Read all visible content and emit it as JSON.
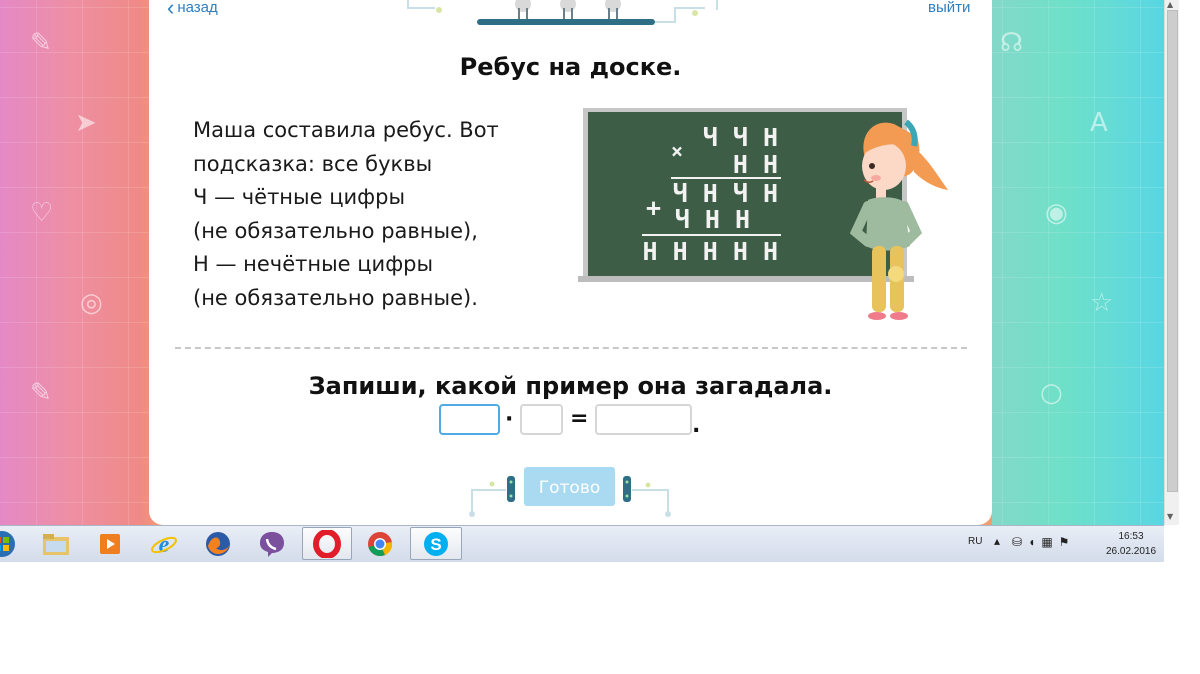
{
  "nav": {
    "back_label": "назад",
    "exit_label": "выйти"
  },
  "title": "Ребус на доске.",
  "story_lines": [
    "Маша составила ребус. Вот",
    "подсказка: все буквы",
    "Ч — чётные цифры",
    "(не обязательно равные),",
    "Н — нечётные цифры",
    "(не обязательно равные)."
  ],
  "board": {
    "color": "#3e5d46",
    "lines": {
      "multiplicand": "Ч Ч Н",
      "multiplier": "Н Н",
      "partial1": "Ч Н Ч Н",
      "partial2": "Ч Н Н",
      "result": "Н Н Н Н Н"
    },
    "times_sign": "×",
    "plus_sign": "+"
  },
  "task": "Запиши, какой пример она загадала.",
  "answer": {
    "multiply_sign": "·",
    "equals_sign": "=",
    "period": ".",
    "field1_value": "",
    "field2_value": "",
    "field3_value": ""
  },
  "ready_button": "Готово",
  "colors": {
    "accent": "#2e7fc1",
    "button_disabled": "#a9daf1",
    "input_focus": "#52a9e3"
  },
  "taskbar": {
    "apps": [
      "start-orb",
      "file-explorer",
      "media-player",
      "internet-explorer",
      "firefox",
      "viber",
      "opera",
      "chrome",
      "skype"
    ],
    "language": "RU",
    "time": "16:53",
    "date": "26.02.2016"
  }
}
